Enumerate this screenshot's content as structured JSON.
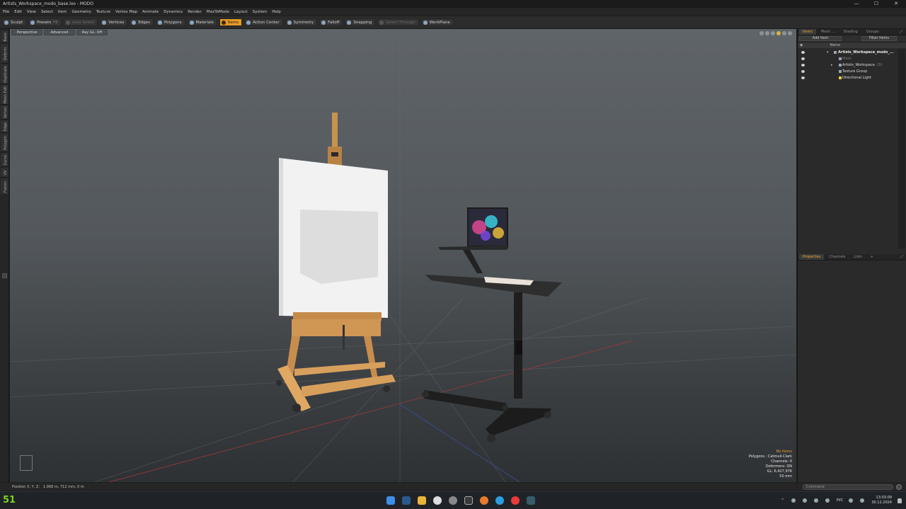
{
  "window": {
    "title": "Artists_Workspace_modo_base.lxo - MODO",
    "controls": [
      "—",
      "☐",
      "✕"
    ]
  },
  "menu": [
    "File",
    "Edit",
    "View",
    "Select",
    "Item",
    "Geometry",
    "Texture",
    "Vertex Map",
    "Animate",
    "Dynamics",
    "Render",
    "MaxToModo",
    "Layout",
    "System",
    "Help"
  ],
  "toolbar": {
    "sculpt": "Sculpt",
    "presets": "Presets",
    "presets_key": "F6",
    "auto_select": "Auto Select",
    "vertices": "Vertices",
    "edges": "Edges",
    "polygons": "Polygons",
    "materials": "Materials",
    "items": "Items",
    "action_center": "Action Center",
    "symmetry": "Symmetry",
    "falloff": "Falloff",
    "snapping": "Snapping",
    "select_through": "Select Through",
    "workplane": "WorkPlane"
  },
  "left_tabs": [
    "Basic",
    "Deform",
    "Duplicate",
    "Mesh Edit",
    "Vertex",
    "Edge",
    "Polygon",
    "Curve",
    "UV",
    "Fusion"
  ],
  "viewport": {
    "tabs": [
      "Perspective",
      "Advanced",
      "Ray GL: Off"
    ],
    "stats": {
      "selection": "No Items",
      "polygons": "Polygons : Catmull-Clark",
      "channels": "Channels: 0",
      "deformers": "Deformers: ON",
      "gl": "GL: 6,427,976",
      "distance": "50 mm"
    }
  },
  "status": {
    "position_label": "Position X, Y, Z:",
    "position_value": "1.968 m, 712 mm, 0 m"
  },
  "items_panel": {
    "tabs": [
      "Items",
      "Mesh ...",
      "Shading",
      "Groups"
    ],
    "add_item": "Add Item",
    "filter_items": "Filter Items",
    "col_name": "Name",
    "tree": [
      {
        "label": "Artists_Workspace_modo_...",
        "bold": true,
        "dim": false,
        "count": ""
      },
      {
        "label": "Mesh",
        "bold": false,
        "dim": true,
        "count": ""
      },
      {
        "label": "Artists_Workspace",
        "bold": false,
        "dim": false,
        "count": "(3)"
      },
      {
        "label": "Texture Group",
        "bold": false,
        "dim": false,
        "count": ""
      },
      {
        "label": "Directional Light",
        "bold": false,
        "dim": false,
        "count": ""
      }
    ]
  },
  "properties_panel": {
    "tabs": [
      "Properties",
      "Channels",
      "Lists"
    ],
    "add": "+"
  },
  "command": {
    "placeholder": "Command"
  },
  "taskbar": {
    "widget_number": "51",
    "lang": "РУС",
    "time": "13:03:09",
    "date": "30.12.2024"
  },
  "colors": {
    "accent": "#e79a25",
    "viewport_top": "#5f6468",
    "viewport_bottom": "#2e3134",
    "widget_green": "#7ed321"
  }
}
